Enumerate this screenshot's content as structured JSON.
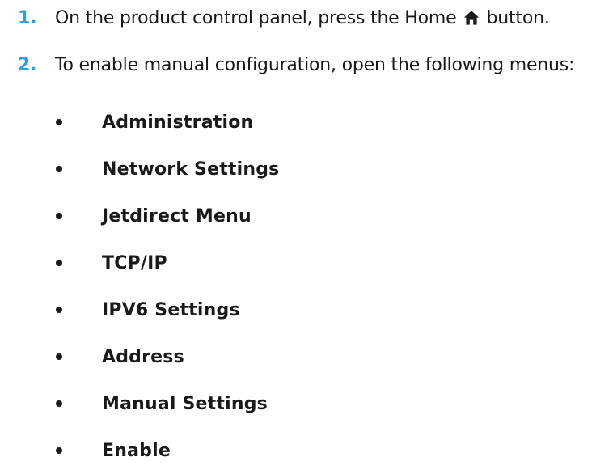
{
  "steps": [
    {
      "number": "1.",
      "text_before": "On the product control panel, press the Home",
      "icon": "home-icon",
      "text_after": "button."
    },
    {
      "number": "2.",
      "text": "To enable manual configuration, open the following menus:"
    }
  ],
  "menus": [
    "Administration",
    "Network Settings",
    "Jetdirect Menu",
    "TCP/IP",
    "IPV6 Settings",
    "Address",
    "Manual Settings",
    "Enable"
  ],
  "colors": {
    "step_number": "#2f9fd8",
    "text": "#1a1a1a"
  }
}
